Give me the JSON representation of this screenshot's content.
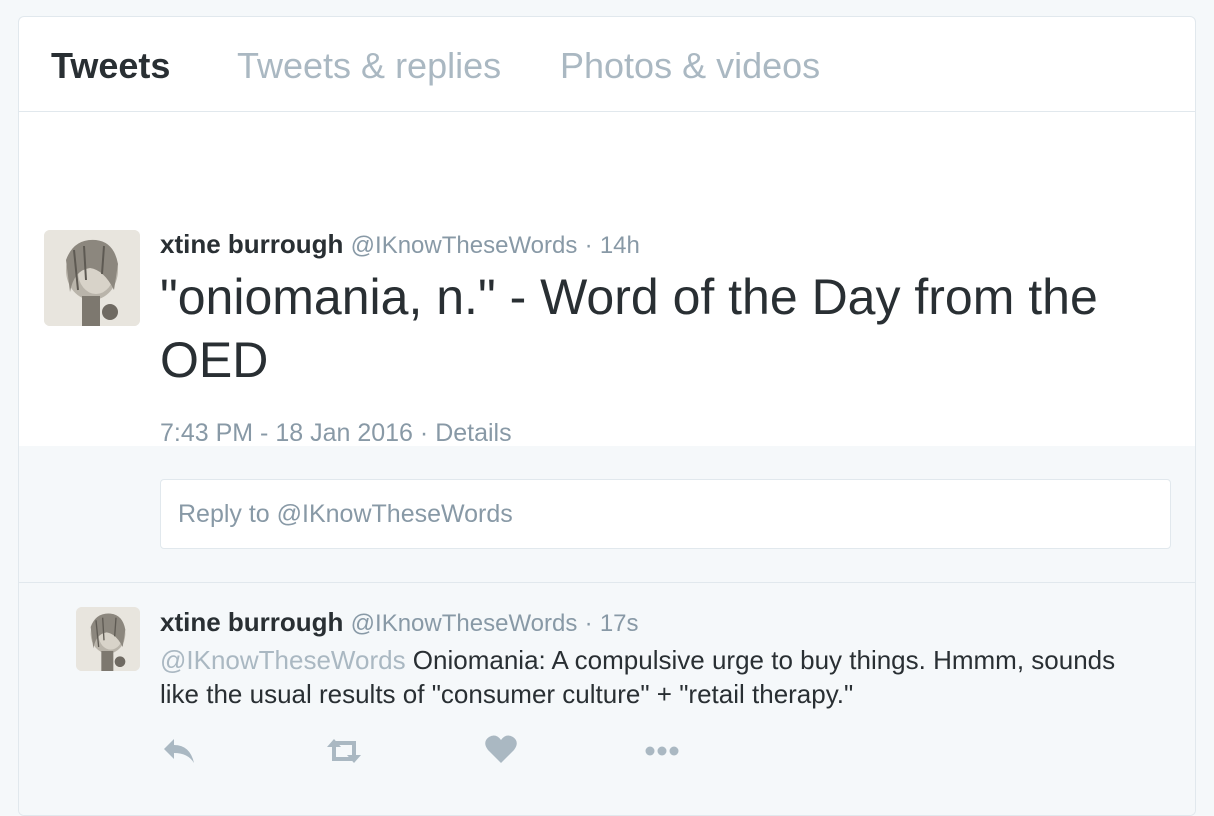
{
  "tabs": [
    {
      "label": "Tweets",
      "active": true
    },
    {
      "label": "Tweets & replies",
      "active": false
    },
    {
      "label": "Photos & videos",
      "active": false
    }
  ],
  "main_tweet": {
    "name": "xtine burrough",
    "handle": "@IKnowTheseWords",
    "dot": "·",
    "time": "14h",
    "text": "\"oniomania, n.\" - Word of the Day from the OED",
    "timestamp": "7:43 PM - 18 Jan 2016",
    "details": "Details"
  },
  "reply_box": {
    "placeholder": "Reply to @IKnowTheseWords"
  },
  "reply_tweet": {
    "name": "xtine burrough",
    "handle": "@IKnowTheseWords",
    "dot": "·",
    "time": "17s",
    "mention": "@IKnowTheseWords",
    "text": " Oniomania: A compulsive urge to buy things. Hmmm, sounds like the usual results of \"consumer culture\" + \"retail therapy.\""
  },
  "icons": {
    "reply": "reply-icon",
    "retweet": "retweet-icon",
    "like": "heart-icon",
    "more": "more-icon",
    "icon_color": "#aab8c2"
  },
  "colors": {
    "text": "#292f33",
    "muted": "#8899a6",
    "light": "#aab8c2",
    "border": "#e1e8ed",
    "background": "#f5f8fa"
  }
}
